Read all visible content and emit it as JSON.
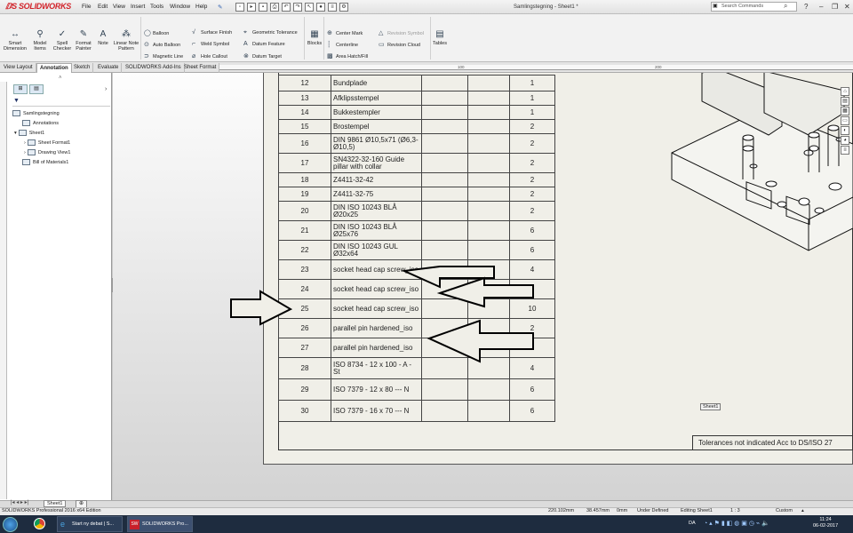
{
  "app": {
    "logo": "SOLIDWORKS",
    "menu": [
      "File",
      "Edit",
      "View",
      "Insert",
      "Tools",
      "Window",
      "Help"
    ],
    "document_title": "Samlingstegning - Sheet1 *",
    "search_placeholder": "Search Commands"
  },
  "ribbon": {
    "smart_dimension": "Smart Dimension",
    "model_items": "Model Items",
    "spell_checker": "Spell Checker",
    "format_painter": "Format Painter",
    "note": "Note",
    "linear_note_pattern": "Linear Note Pattern",
    "balloon": "Balloon",
    "auto_balloon": "Auto Balloon",
    "magnetic_line": "Magnetic Line",
    "surface_finish": "Surface Finish",
    "weld_symbol": "Weld Symbol",
    "hole_callout": "Hole Callout",
    "geometric_tolerance": "Geometric Tolerance",
    "datum_feature": "Datum Feature",
    "datum_target": "Datum Target",
    "blocks": "Blocks",
    "center_mark": "Center Mark",
    "centerline": "Centerline",
    "area_hatch": "Area Hatch/Fill",
    "revision_symbol": "Revision Symbol",
    "revision_cloud": "Revision Cloud",
    "tables": "Tables"
  },
  "tabs": [
    "View Layout",
    "Annotation",
    "Sketch",
    "Evaluate",
    "SOLIDWORKS Add-Ins",
    "Sheet Format"
  ],
  "active_tab": "Annotation",
  "ruler_ticks": [
    "100",
    "200"
  ],
  "tree": {
    "root": "Samlingstegning",
    "annotations": "Annotations",
    "sheet": "Sheet1",
    "sheet_format": "Sheet Format1",
    "drawing_view": "Drawing View1",
    "bom": "Bill of Materials1"
  },
  "bom_rows": [
    {
      "no": "12",
      "desc": "Bundplade",
      "qty": "1"
    },
    {
      "no": "13",
      "desc": "Afklipsstempel",
      "qty": "1"
    },
    {
      "no": "14",
      "desc": "Bukkestempler",
      "qty": "1"
    },
    {
      "no": "15",
      "desc": "Brostempel",
      "qty": "2"
    },
    {
      "no": "16",
      "desc": "DIN 9861 Ø10,5x71 (Ø6,3-Ø10,5)",
      "qty": "2"
    },
    {
      "no": "17",
      "desc": "SN4322-32-160 Guide pillar with collar",
      "qty": "2"
    },
    {
      "no": "18",
      "desc": "Z4411-32-42",
      "qty": "2"
    },
    {
      "no": "19",
      "desc": "Z4411-32-75",
      "qty": "2"
    },
    {
      "no": "20",
      "desc": "DIN ISO 10243 BLÅ Ø20x25",
      "qty": "2"
    },
    {
      "no": "21",
      "desc": "DIN ISO 10243 BLÅ Ø25x76",
      "qty": "6"
    },
    {
      "no": "22",
      "desc": "DIN ISO 10243 GUL Ø32x64",
      "qty": "6"
    },
    {
      "no": "23",
      "desc": "socket head cap screw_iso",
      "qty": "4"
    },
    {
      "no": "24",
      "desc": "socket head cap screw_iso",
      "qty": "4"
    },
    {
      "no": "25",
      "desc": "socket head cap screw_iso",
      "qty": "10"
    },
    {
      "no": "26",
      "desc": "parallel pin hardened_iso",
      "qty": "2"
    },
    {
      "no": "27",
      "desc": "parallel pin hardened_iso",
      "qty": "6"
    },
    {
      "no": "28",
      "desc": "ISO 8734 - 12 x 100 - A - St",
      "qty": "4"
    },
    {
      "no": "29",
      "desc": "ISO 7379 - 12 x 80 --- N",
      "qty": "6"
    },
    {
      "no": "30",
      "desc": "ISO 7379 - 16 x 70 --- N",
      "qty": "6"
    }
  ],
  "tolerance_note": "Tolerances not indicated Acc to DS/ISO 27",
  "sheet_label": "Sheet1",
  "sheet_tab": "Sheet1",
  "status": {
    "edition": "SOLIDWORKS Professional 2016 x64 Edition",
    "x": "220.102mm",
    "y": "38.457mm",
    "z": "0mm",
    "state": "Under Defined",
    "editing": "Editing Sheet1",
    "scale": "1 : 3",
    "units": "Custom"
  },
  "taskbar": {
    "app1": "Start ny debat | S...",
    "app2": "SOLIDWORKS Pro...",
    "lang": "DA",
    "time": "11:24",
    "date": "06-02-2017"
  }
}
